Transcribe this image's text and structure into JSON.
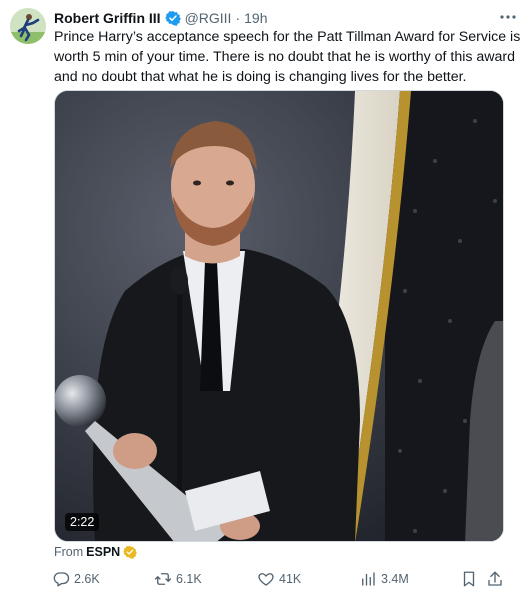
{
  "author": {
    "display_name": "Robert Griffin III",
    "handle": "@RGIII",
    "separator": "·",
    "time": "19h",
    "verified_color": "#1d9bf0"
  },
  "tweet": {
    "text": "Prince Harry’s acceptance speech for the Patt Tillman Award for Service is worth 5 min of your time. There is no doubt that he is worthy of this award and no doubt that what he is doing is changing lives for the better."
  },
  "media": {
    "duration": "2:22"
  },
  "source": {
    "prefix": "From",
    "name": "ESPN",
    "badge_color": "#e8b923"
  },
  "actions": {
    "replies": "2.6K",
    "reposts": "6.1K",
    "likes": "41K",
    "views": "3.4M"
  },
  "icons": [
    "more-icon",
    "verified-badge-icon",
    "reply-icon",
    "repost-icon",
    "like-icon",
    "views-icon",
    "bookmark-icon",
    "share-icon",
    "gold-verified-icon"
  ]
}
